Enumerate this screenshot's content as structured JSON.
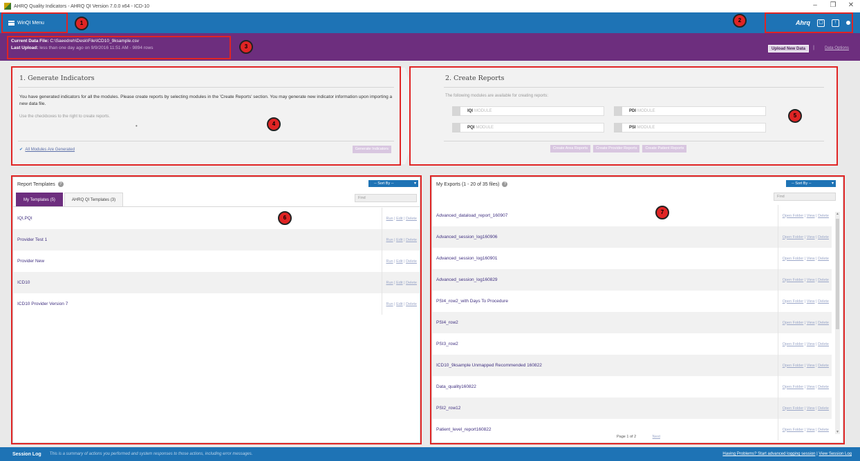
{
  "window": {
    "title": "AHRQ Quality Indicators - AHRQ QI Version 7.0.0 x64 - ICD-10",
    "controls": [
      "–",
      "❐",
      "✕"
    ]
  },
  "header": {
    "menu_label": "WinQI Menu",
    "logo_text": "Ahrq",
    "icons": [
      "window-icon",
      "export-icon",
      "status-dot-icon"
    ],
    "color": "#1e73b5"
  },
  "databar": {
    "file_label": "Current Data File:",
    "file_path": "C:\\Saeedreh\\Desk\\File\\ICD10_9ksample.csv",
    "upload_label": "Last Upload:",
    "upload_info": "less than one day ago on 9/9/2016 11:51 AM - 9894 rows",
    "upload_button": "Upload New Data",
    "separator": "|",
    "options_link": "Data Options",
    "color": "#6d2e7e"
  },
  "callouts": [
    "1",
    "2",
    "3",
    "4",
    "5",
    "6",
    "7"
  ],
  "generate": {
    "title": "1. Generate Indicators",
    "description": "You have generated indicators for all the modules. Please create reports by selecting modules in the 'Create Reports' section. You may generate new indicator information upon importing a new data file.",
    "hint": "Use the checkboxes to the right to create reports.",
    "dot": "•",
    "all_generated_link": "All Modules Are Generated",
    "generate_button": "Generate Indicators"
  },
  "reports": {
    "title": "2. Create Reports",
    "description": "The following modules are available for creating reports:",
    "modules": [
      {
        "code": "IQI",
        "word": "MODULE"
      },
      {
        "code": "PDI",
        "word": "MODULE"
      },
      {
        "code": "PQI",
        "word": "MODULE"
      },
      {
        "code": "PSI",
        "word": "MODULE"
      }
    ],
    "buttons": [
      "Create Area Reports",
      "Create Provider Reports",
      "Create Patient Reports"
    ]
  },
  "templates": {
    "title": "Report Templates",
    "sort_label": "-- Sort By --",
    "find_placeholder": "Find",
    "tabs": [
      "My Templates (5)",
      "AHRQ QI Templates (3)"
    ],
    "actions": [
      "Run",
      "Edit",
      "Delete"
    ],
    "rows": [
      "IQI,PQI",
      "Provider Test 1",
      "Provider New",
      "ICD10",
      "ICD10 Provider Version 7"
    ]
  },
  "exports": {
    "title": "My Exports (1 - 20 of 35 files)",
    "sort_label": "-- Sort By --",
    "find_placeholder": "Find",
    "actions": [
      "Open Folder",
      "View",
      "Delete"
    ],
    "rows": [
      "Advanced_dataload_report_160907",
      "Advanced_session_log160906",
      "Advanced_session_log160901",
      "Advanced_session_log160829",
      "PSI4_row2_with Days To Procedure",
      "PSI4_row2",
      "PSI3_row2",
      "ICD10_9ksample Unmapped Recommended 160822",
      "Data_quality160822",
      "PSI2_row12",
      "Patient_level_report160822"
    ],
    "pager": "Page 1 of 2",
    "next_link": "Next"
  },
  "footer": {
    "label": "Session Log",
    "message": "This is a summary of actions you performed and system responses to those actions, including error messages.",
    "link1": "Having Problems? Start advanced logging session",
    "separator": "|",
    "link2": "View Session Log"
  }
}
